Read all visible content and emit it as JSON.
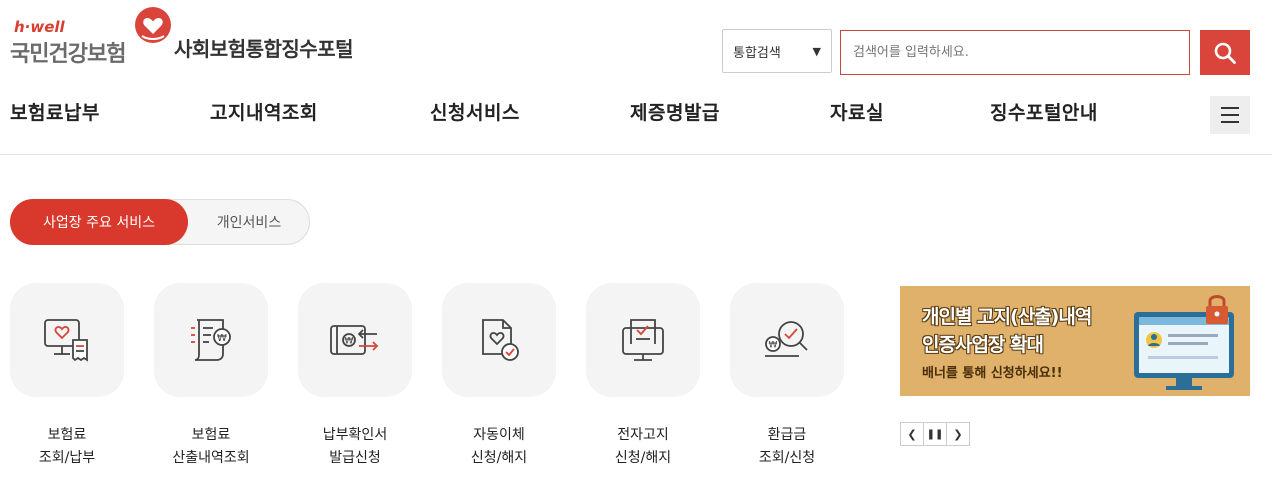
{
  "brand": {
    "hwell": "h·well",
    "name": "국민건강보험",
    "portal": "사회보험통합징수포털",
    "accent": "#d9453a"
  },
  "search": {
    "select_value": "통합검색",
    "placeholder": "검색어를 입력하세요."
  },
  "gnb": [
    "보험료납부",
    "고지내역조회",
    "신청서비스",
    "제증명발급",
    "자료실",
    "징수포털안내"
  ],
  "tabs": [
    {
      "label": "사업장 주요 서비스",
      "active": true
    },
    {
      "label": "개인서비스",
      "active": false
    }
  ],
  "services": [
    {
      "line1": "보험료",
      "line2": "조회/납부",
      "icon": "monitor-heart-icon"
    },
    {
      "line1": "보험료",
      "line2": "산출내역조회",
      "icon": "document-won-icon"
    },
    {
      "line1": "납부확인서",
      "line2": "발급신청",
      "icon": "payment-certificate-icon"
    },
    {
      "line1": "자동이체",
      "line2": "신청/해지",
      "icon": "document-check-icon"
    },
    {
      "line1": "전자고지",
      "line2": "신청/해지",
      "icon": "e-notice-icon"
    },
    {
      "line1": "환급금",
      "line2": "조회/신청",
      "icon": "refund-search-icon"
    }
  ],
  "banner": {
    "line1": "개인별 고지(산출)내역",
    "line2": "인증사업장 확대",
    "line3": "배너를 통해 신청하세요!!"
  }
}
